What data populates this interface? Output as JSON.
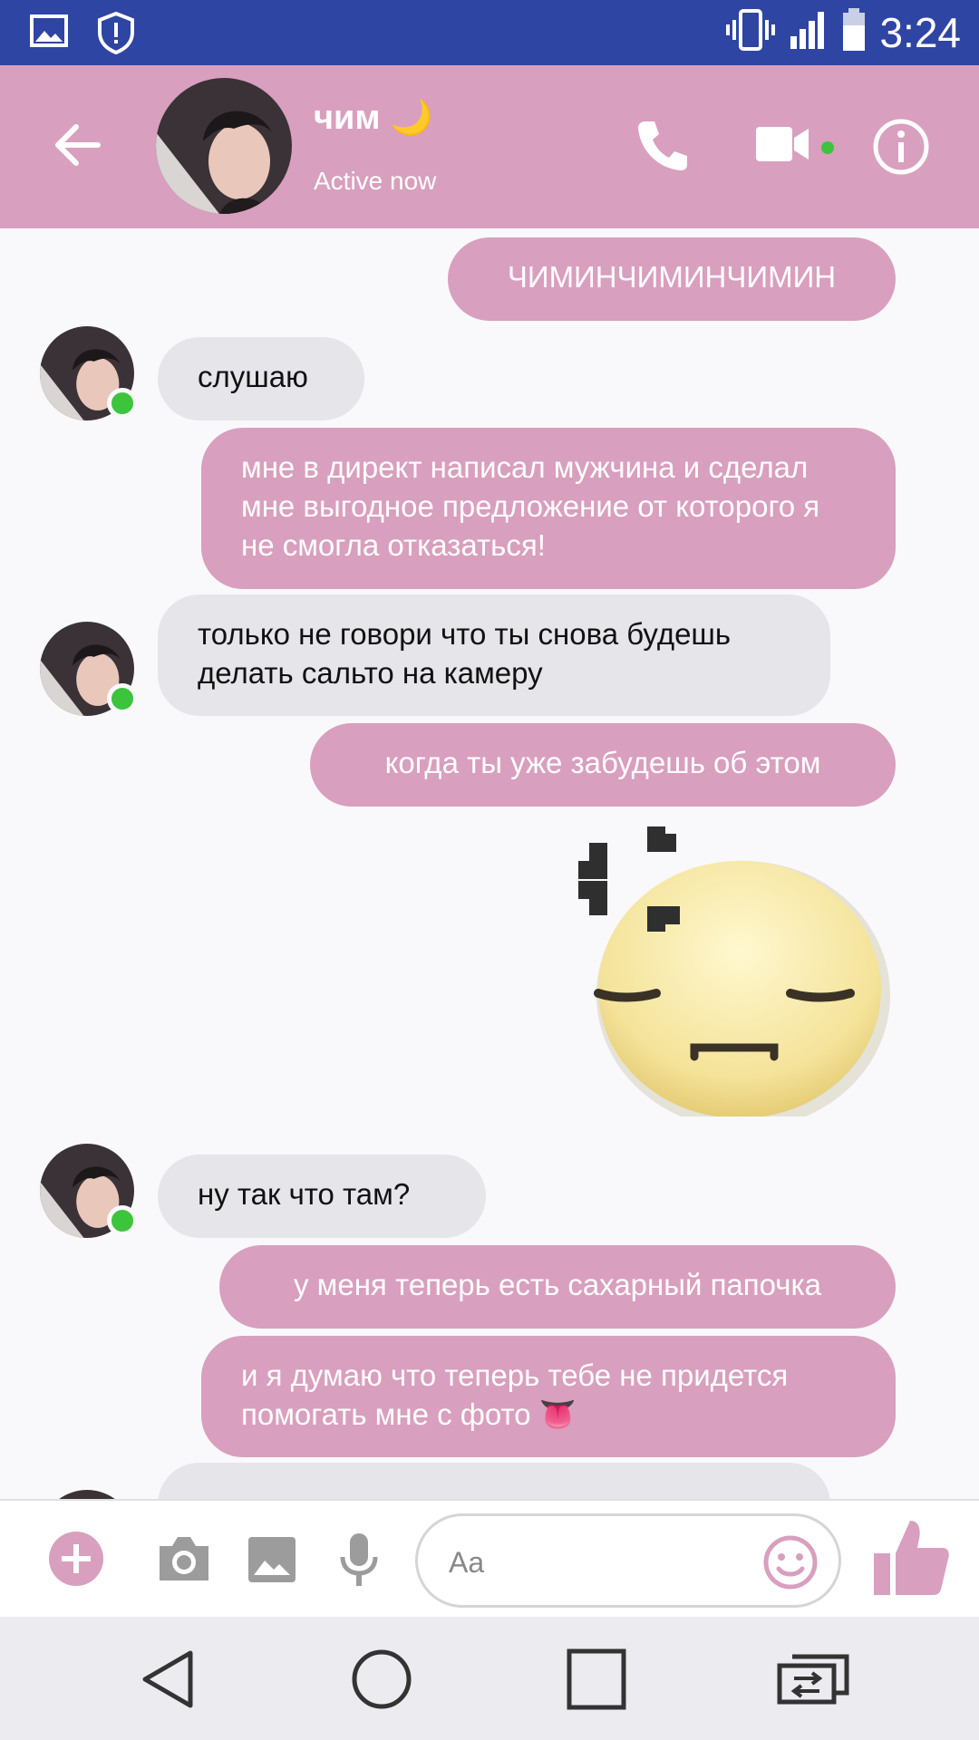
{
  "status_bar": {
    "time": "3:24",
    "left_icons": [
      "image-icon",
      "shield-alert-icon"
    ],
    "right_icons": [
      "vibrate-icon",
      "signal-icon",
      "battery-icon"
    ]
  },
  "header": {
    "contact_name": "чим 🌙",
    "status": "Active now",
    "colors": {
      "bar": "#d99fbe",
      "online": "#3cc43c"
    }
  },
  "messages": [
    {
      "side": "out",
      "text": "ЧИМИНЧИМИНЧИМИН"
    },
    {
      "side": "in",
      "text": "слушаю"
    },
    {
      "side": "out",
      "text": "мне в директ написал мужчина и сделал мне выгодное предложение от которого я не смогла отказаться!"
    },
    {
      "side": "in",
      "text": "только не говори что ты снова будешь делать сальто на камеру"
    },
    {
      "side": "out",
      "text": "когда ты уже забудешь об этом"
    },
    {
      "side": "out",
      "type": "sticker",
      "icon": "annoyed-face-sticker-icon"
    },
    {
      "side": "in",
      "text": "ну так что там?"
    },
    {
      "side": "out",
      "text": "у меня теперь есть сахарный папочка"
    },
    {
      "side": "out",
      "text": "и я думаю что теперь тебе не придется помогать мне с фото 👅"
    }
  ],
  "composer": {
    "placeholder": "Aa",
    "icons": [
      "plus-icon",
      "camera-icon",
      "gallery-icon",
      "microphone-icon",
      "emoji-icon",
      "thumbs-up-icon"
    ],
    "accent": "#d99fbe"
  },
  "nav_bar": {
    "icons": [
      "back-triangle-icon",
      "home-circle-icon",
      "recents-square-icon",
      "switch-app-icon"
    ]
  }
}
